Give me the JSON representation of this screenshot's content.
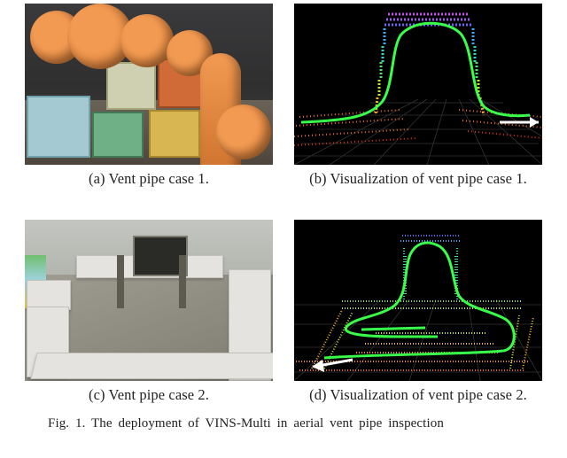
{
  "figure": {
    "subfigs": {
      "a": {
        "label": "(a) Vent pipe case 1."
      },
      "b": {
        "label": "(b) Visualization of vent pipe case 1."
      },
      "c": {
        "label": "(c) Vent pipe case 2."
      },
      "d": {
        "label": "(d) Visualization of vent pipe case 2."
      }
    },
    "main_caption": "Fig. 1.    The deployment of VINS-Multi in aerial vent pipe inspection"
  }
}
